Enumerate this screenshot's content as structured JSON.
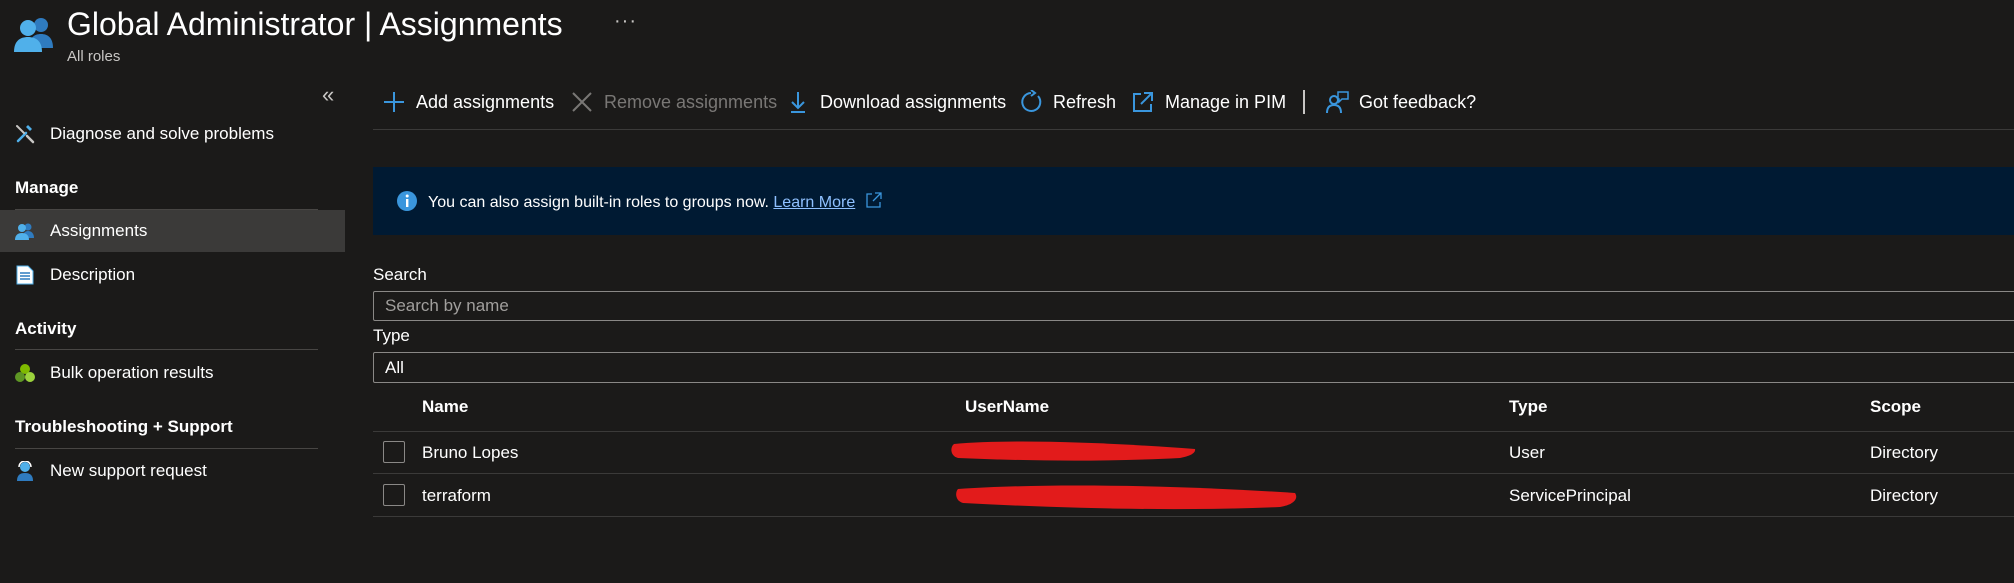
{
  "header": {
    "title": "Global Administrator | Assignments",
    "subtitle": "All roles",
    "more_label": "···"
  },
  "sidebar": {
    "collapse_label": "«",
    "diagnose_label": "Diagnose and solve problems",
    "sections": [
      {
        "heading": "Manage"
      },
      {
        "heading": "Activity"
      },
      {
        "heading": "Troubleshooting + Support"
      }
    ],
    "items": [
      {
        "label": "Assignments",
        "icon": "assignments-icon",
        "active": true
      },
      {
        "label": "Description",
        "icon": "document-icon"
      },
      {
        "label": "Bulk operation results",
        "icon": "bulk-results-icon"
      },
      {
        "label": "New support request",
        "icon": "support-icon"
      }
    ]
  },
  "toolbar": {
    "add_label": "Add assignments",
    "remove_label": "Remove assignments",
    "download_label": "Download assignments",
    "refresh_label": "Refresh",
    "pim_label": "Manage in PIM",
    "feedback_label": "Got feedback?"
  },
  "banner": {
    "text": "You can also assign built-in roles to groups now.",
    "link": "Learn More"
  },
  "filters": {
    "search_label": "Search",
    "search_placeholder": "Search by name",
    "type_label": "Type",
    "type_value": "All"
  },
  "table": {
    "columns": [
      "Name",
      "UserName",
      "Type",
      "Scope"
    ],
    "rows": [
      {
        "name": "Bruno Lopes",
        "username_redacted": true,
        "type": "User",
        "scope": "Directory"
      },
      {
        "name": "terraform",
        "username_redacted": true,
        "type": "ServicePrincipal",
        "scope": "Directory"
      }
    ]
  },
  "colors": {
    "background": "#1b1a19",
    "accent": "#3a96dd",
    "banner_bg": "#001a33",
    "link": "#8ec0ff",
    "redaction": "#e21b1b"
  }
}
